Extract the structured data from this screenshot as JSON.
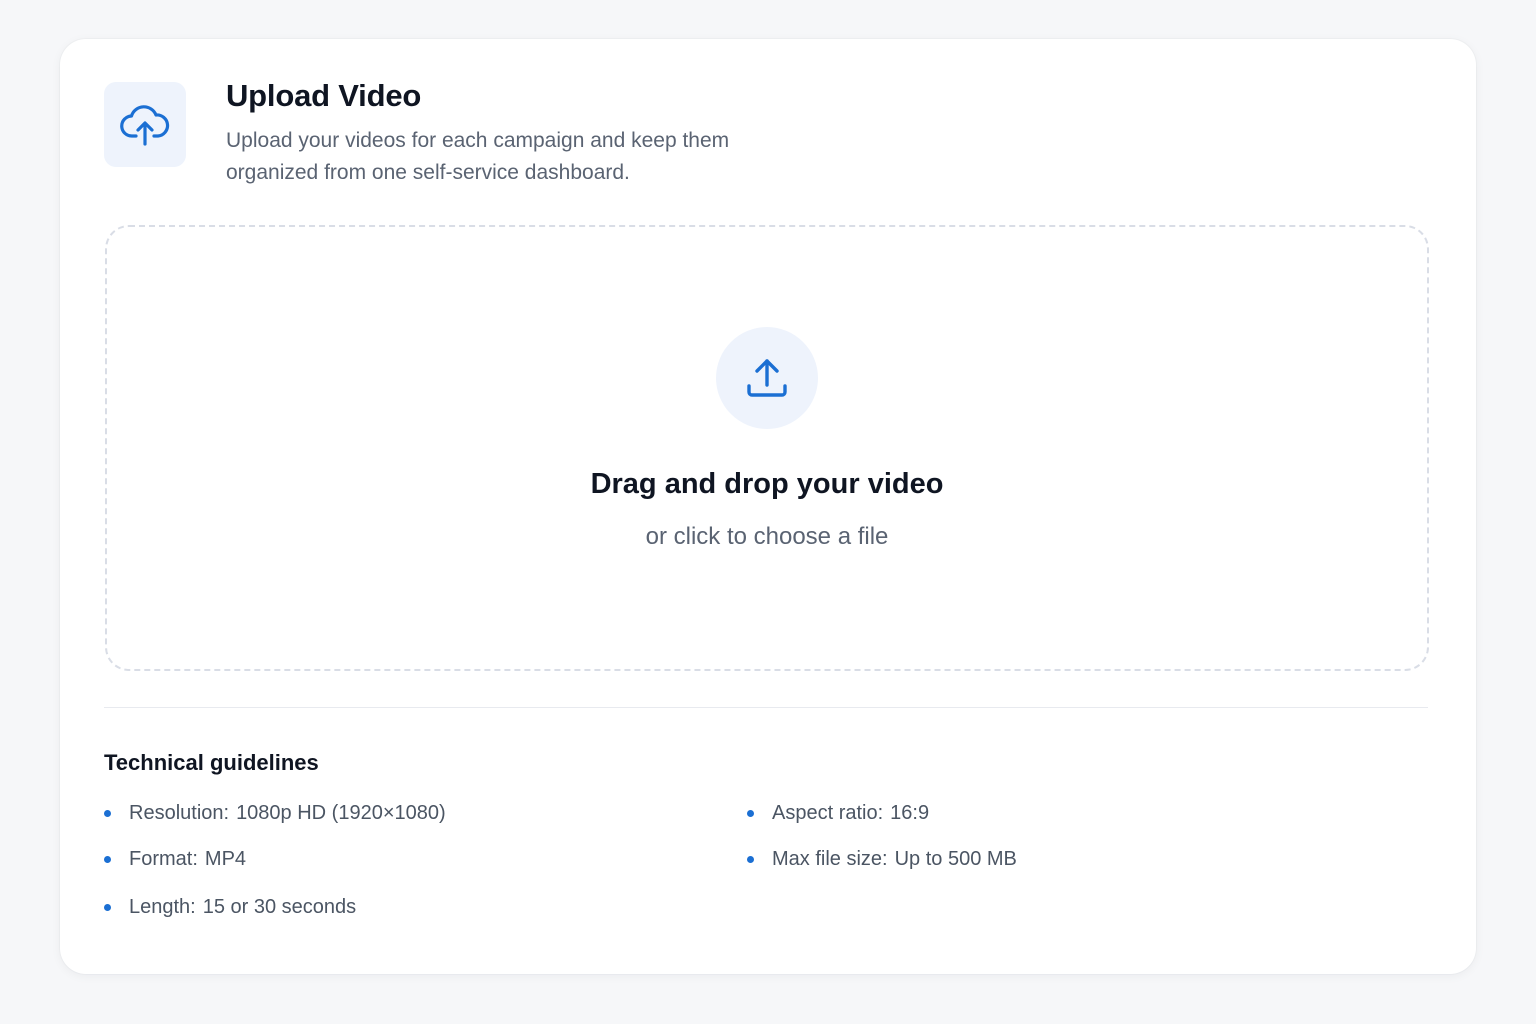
{
  "header": {
    "title": "Upload Video",
    "subtitle": "Upload your videos for each campaign and keep them organized from one self-service dashboard.",
    "icon": "cloud-upload-icon"
  },
  "dropzone": {
    "icon": "upload-tray-icon",
    "title": "Drag and drop your video",
    "subtitle": "or click to choose a file"
  },
  "guidelines": {
    "title": "Technical guidelines",
    "items": [
      {
        "label": "Resolution:",
        "value": "1080p HD (1920×1080)"
      },
      {
        "label": "Format:",
        "value": "MP4"
      },
      {
        "label": "Length:",
        "value": "15 or 30 seconds"
      },
      {
        "label": "Aspect ratio:",
        "value": "16:9"
      },
      {
        "label": "Max file size:",
        "value": "Up to 500 MB"
      }
    ]
  },
  "colors": {
    "accent": "#1b6fd3",
    "icon_bg": "#eef3fc",
    "text_primary": "#0f1522",
    "text_secondary": "#5a6372",
    "dash_border": "#d9dde6"
  }
}
